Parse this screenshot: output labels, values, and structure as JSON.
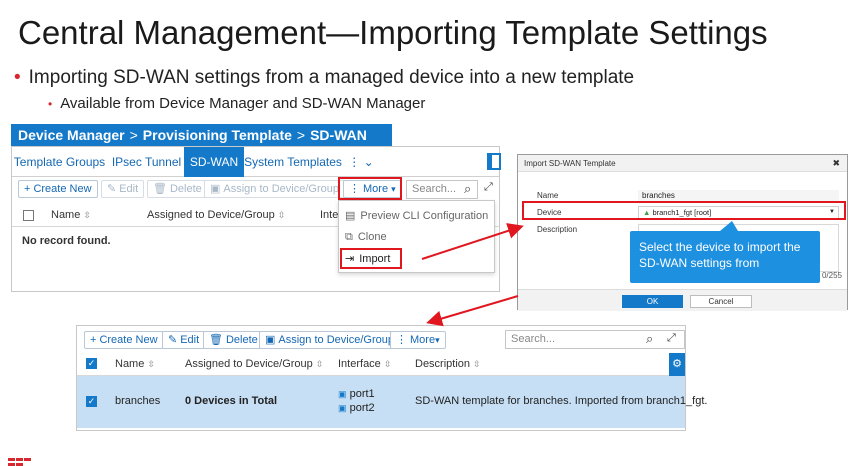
{
  "slide": {
    "title": "Central Management—Importing Template Settings",
    "bullet1": "Importing SD-WAN settings from a managed device into a new template",
    "bullet2": "Available from Device Manager and SD-WAN Manager"
  },
  "breadcrumb": {
    "part1": "Device Manager",
    "sep1": ">",
    "part2": "Provisioning Template",
    "sep2": ">",
    "part3": "SD-WAN"
  },
  "panel1": {
    "tabs": [
      "Template Groups",
      "IPsec Tunnel",
      "SD-WAN",
      "System Templates"
    ],
    "toolbar": {
      "create_new": "Create New",
      "edit": "Edit",
      "delete": "Delete",
      "assign": "Assign to Device/Group",
      "more": "More",
      "search_placeholder": "Search..."
    },
    "columns": [
      "Name",
      "Assigned to Device/Group",
      "Inte"
    ],
    "empty_text": "No record found.",
    "menu": {
      "preview": "Preview CLI Configuration",
      "clone": "Clone",
      "import": "Import"
    }
  },
  "dialog": {
    "title": "Import SD-WAN Template",
    "name_label": "Name",
    "name_value": "branches",
    "device_label": "Device",
    "device_value": "branch1_fgt [root]",
    "description_label": "Description",
    "counter": "0/255",
    "ok": "OK",
    "cancel": "Cancel"
  },
  "callout": {
    "line1": "Select the device to import the",
    "line2": "SD-WAN settings from"
  },
  "panel2": {
    "toolbar": {
      "create_new": "Create New",
      "edit": "Edit",
      "delete": "Delete",
      "assign": "Assign to Device/Group",
      "more": "More",
      "search_placeholder": "Search..."
    },
    "columns": [
      "Name",
      "Assigned to Device/Group",
      "Interface",
      "Description"
    ],
    "row": {
      "name": "branches",
      "assigned": "0 Devices in Total",
      "interface1": "port1",
      "interface2": "port2",
      "description": "SD-WAN template for branches. Imported from branch1_fgt."
    }
  },
  "colors": {
    "accent": "#1479c9",
    "highlight": "#e0171f",
    "callout": "#1e90e0",
    "selected_row": "#c7dff4"
  },
  "icons": [
    "plus-icon",
    "pencil-icon",
    "trash-icon",
    "assign-icon",
    "kebab-icon",
    "search-icon",
    "expand-icon",
    "gear-icon",
    "close-icon",
    "import-icon",
    "clone-icon",
    "preview-icon",
    "interface-icon",
    "up-arrow-icon"
  ]
}
